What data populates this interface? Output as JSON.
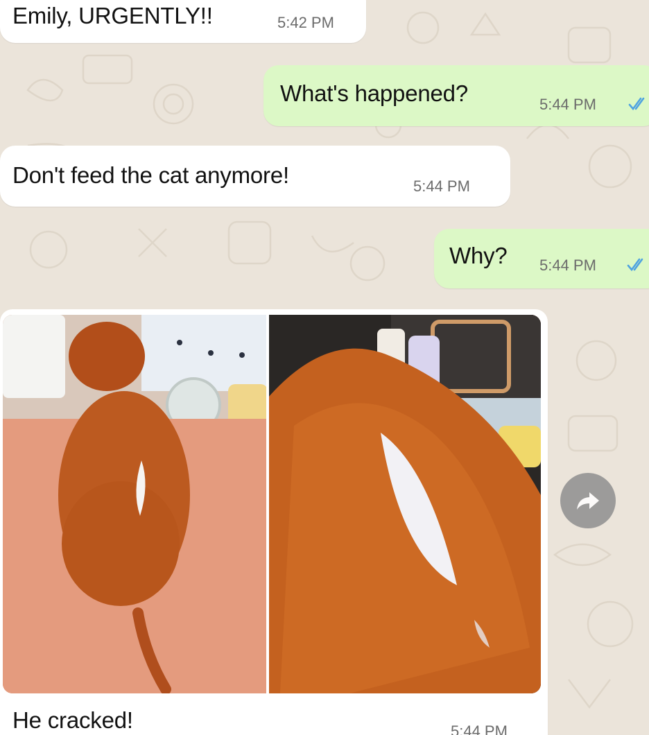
{
  "wallpaper": {
    "color": "#ebe4da",
    "icon_name": "doodle-pattern"
  },
  "messages": [
    {
      "direction": "incoming",
      "text": "Emily, URGENTLY!!",
      "time": "5:42 PM"
    },
    {
      "direction": "outgoing",
      "text": "What's happened?",
      "time": "5:44 PM",
      "status_icon": "double-check-read-icon"
    },
    {
      "direction": "incoming",
      "text": "Don't feed the cat anymore!",
      "time": "5:44 PM"
    },
    {
      "direction": "outgoing",
      "text": "Why?",
      "time": "5:44 PM",
      "status_icon": "double-check-read-icon"
    },
    {
      "direction": "incoming",
      "type": "image",
      "caption": "He cracked!",
      "time": "5:44 PM"
    }
  ],
  "colors": {
    "incoming_bubble": "#ffffff",
    "outgoing_bubble": "#dcf8c6",
    "read_ticks": "#4fa3e0"
  },
  "actions": {
    "forward_icon": "forward-arrow-icon"
  }
}
